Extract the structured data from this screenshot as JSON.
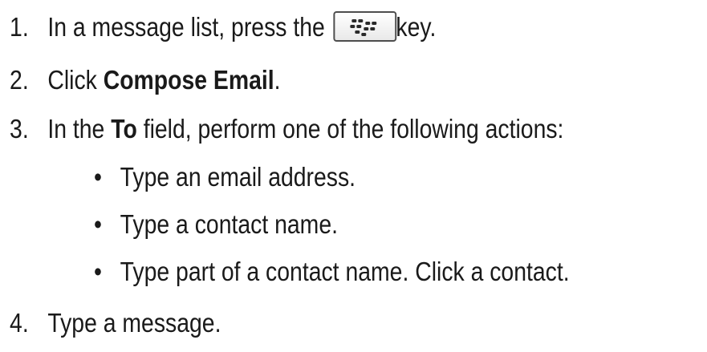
{
  "steps": [
    {
      "number": "1.",
      "before": "In a message list, press the",
      "after": "key.",
      "key_icon": "blackberry-menu-key-icon"
    },
    {
      "number": "2.",
      "before": "Click ",
      "bold": "Compose Email",
      "after": "."
    },
    {
      "number": "3.",
      "before": "In the ",
      "bold": "To",
      "after": " field, perform one of the following actions:"
    },
    {
      "number": "4.",
      "text": "Type a message."
    }
  ],
  "bullets": [
    {
      "symbol": "•",
      "text": "Type an email address."
    },
    {
      "symbol": "•",
      "text": "Type a contact name."
    },
    {
      "symbol": "•",
      "text": "Type part of a contact name. Click a contact."
    }
  ]
}
